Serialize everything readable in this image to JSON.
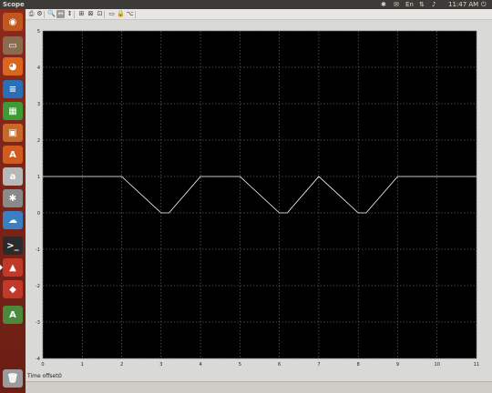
{
  "window": {
    "title": "Scope"
  },
  "top_panel": {
    "clock": "11:47 AM",
    "tray_icons": [
      "bluetooth-icon",
      "mail-icon",
      "keyboard-layout-icon",
      "network-icon",
      "volume-icon",
      "power-icon"
    ],
    "keyboard_layout": "En"
  },
  "launcher": {
    "items": [
      {
        "name": "launcher-dash",
        "icon": "ubuntu-logo-icon",
        "glyph": "◉",
        "color": "#c1571f"
      },
      {
        "name": "launcher-files",
        "icon": "folder-icon",
        "glyph": "▭",
        "color": "#8a6b4e"
      },
      {
        "name": "launcher-firefox",
        "icon": "firefox-icon",
        "glyph": "◕",
        "color": "#d9661c"
      },
      {
        "name": "launcher-writer",
        "icon": "document-icon",
        "glyph": "≡",
        "color": "#2a6fb5"
      },
      {
        "name": "launcher-calc",
        "icon": "spreadsheet-icon",
        "glyph": "▦",
        "color": "#3e9a35"
      },
      {
        "name": "launcher-impress",
        "icon": "presentation-icon",
        "glyph": "▣",
        "color": "#c8692a"
      },
      {
        "name": "launcher-software",
        "icon": "software-center-icon",
        "glyph": "A",
        "color": "#d25a1a"
      },
      {
        "name": "launcher-amazon",
        "icon": "amazon-icon",
        "glyph": "a",
        "color": "#b8b8b8"
      },
      {
        "name": "launcher-settings",
        "icon": "settings-icon",
        "glyph": "✱",
        "color": "#8a8a8a"
      },
      {
        "name": "launcher-cloud",
        "icon": "cloud-icon",
        "glyph": "☁",
        "color": "#3a7fc4"
      },
      {
        "name": "launcher-terminal",
        "icon": "terminal-icon",
        "glyph": ">_",
        "color": "#2b2b2b"
      },
      {
        "name": "launcher-matlab",
        "icon": "matlab-icon",
        "glyph": "▲",
        "color": "#c0392b"
      },
      {
        "name": "launcher-simulink",
        "icon": "simulink-icon",
        "glyph": "◆",
        "color": "#c0392b"
      },
      {
        "name": "launcher-updater",
        "icon": "software-updater-icon",
        "glyph": "A",
        "color": "#4a8a3a"
      },
      {
        "name": "launcher-trash",
        "icon": "trash-icon",
        "glyph": "🗑",
        "color": "#9b9b9b"
      }
    ]
  },
  "toolbar": {
    "buttons": [
      {
        "name": "print-button",
        "icon": "printer-icon",
        "glyph": "⎙"
      },
      {
        "name": "parameters-button",
        "icon": "gear-icon",
        "glyph": "⚙"
      },
      {
        "name": "zoom-button",
        "icon": "zoom-icon",
        "glyph": "🔍"
      },
      {
        "name": "zoom-x-button",
        "icon": "zoom-x-icon",
        "glyph": "↔",
        "pressed": true
      },
      {
        "name": "zoom-y-button",
        "icon": "zoom-y-icon",
        "glyph": "↕"
      },
      {
        "name": "autoscale-button",
        "icon": "autoscale-icon",
        "glyph": "⊞"
      },
      {
        "name": "save-axes-button",
        "icon": "save-axes-icon",
        "glyph": "⊠"
      },
      {
        "name": "restore-axes-button",
        "icon": "restore-axes-icon",
        "glyph": "⊡"
      },
      {
        "name": "floating-scope-button",
        "icon": "floating-scope-icon",
        "glyph": "▭"
      },
      {
        "name": "lock-axes-button",
        "icon": "lock-icon",
        "glyph": "🔒"
      },
      {
        "name": "signal-selector-button",
        "icon": "signal-selector-icon",
        "glyph": "⌥"
      }
    ]
  },
  "status": {
    "label": "Time offset:",
    "value": "0"
  },
  "colors": {
    "plot_background": "#000000",
    "grid": "#8a8a8a",
    "signal": "#ffffff",
    "tick_label": "#222222"
  },
  "chart_data": {
    "type": "line",
    "title": "",
    "xlabel": "",
    "ylabel": "",
    "xlim": [
      0,
      11
    ],
    "ylim": [
      -4,
      5
    ],
    "x_ticks": [
      0,
      1,
      2,
      3,
      4,
      5,
      6,
      7,
      8,
      9,
      10,
      11
    ],
    "y_ticks": [
      -4,
      -3,
      -2,
      -1,
      0,
      1,
      2,
      3,
      4,
      5
    ],
    "grid": true,
    "series": [
      {
        "x": [
          0,
          2,
          3,
          3.2,
          4,
          5,
          6,
          6.2,
          7,
          8,
          8.2,
          9,
          11
        ],
        "values": [
          1,
          1,
          0,
          0,
          1,
          1,
          0,
          0,
          1,
          0,
          0,
          1,
          1
        ]
      }
    ]
  }
}
